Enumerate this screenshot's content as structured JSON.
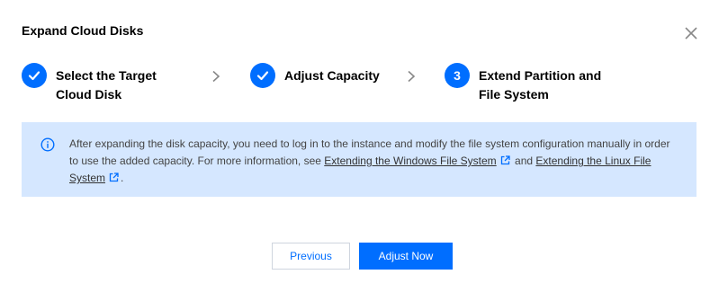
{
  "dialog": {
    "title": "Expand Cloud Disks"
  },
  "steps": [
    {
      "number": "1",
      "line1": "Select the Target",
      "line2": "Cloud Disk",
      "status": "done"
    },
    {
      "number": "2",
      "line1": "Adjust Capacity",
      "line2": "",
      "status": "done"
    },
    {
      "number": "3",
      "line1": "Extend Partition and",
      "line2": "File System",
      "status": "current"
    }
  ],
  "notice": {
    "text_before": "After expanding the disk capacity, you need to log in to the instance and modify the file system configuration manually in order to use the added capacity. For more information, see ",
    "link_windows": "Extending the Windows File System",
    "text_middle": " and ",
    "link_linux": "Extending the Linux File System",
    "text_after": "."
  },
  "buttons": {
    "previous": "Previous",
    "adjust_now": "Adjust Now"
  },
  "colors": {
    "accent": "#006eff",
    "notice_bg": "#d5e7ff"
  },
  "icons": {
    "close": "close-icon",
    "check": "check-icon",
    "chevron": "chevron-right-icon",
    "info": "info-icon",
    "external": "external-link-icon"
  }
}
